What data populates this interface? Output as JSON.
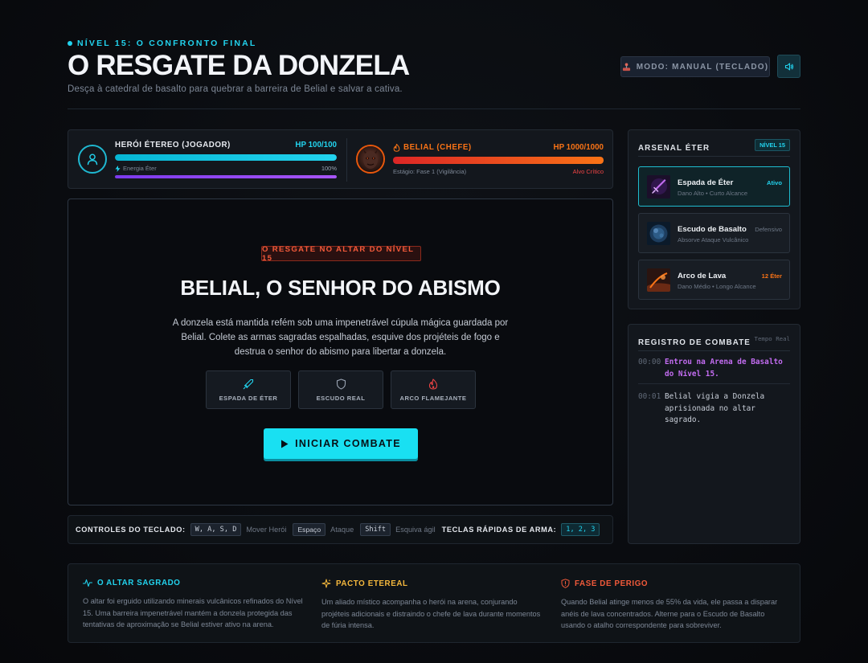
{
  "header": {
    "level_tag": "NÍVEL 15: O CONFRONTO FINAL",
    "title": "O RESGATE DA DONZELA",
    "subtitle": "Desça à catedral de basalto para quebrar a barreira de Belial e salvar a cativa.",
    "mode_label": "MODO: MANUAL (TECLADO)"
  },
  "hero": {
    "name": "HERÓI ÉTEREO (JOGADOR)",
    "hp": "HP 100/100",
    "hp_fraction": 1.0,
    "energy_label": "Energia Éter",
    "energy_pct": "100%",
    "energy_fraction": 1.0
  },
  "boss": {
    "name": "BELIAL (CHEFE)",
    "hp": "HP 1000/1000",
    "hp_fraction": 1.0,
    "stage": "Estágio: Fase 1 (Vigilância)",
    "critical": "Alvo Crítico"
  },
  "arena": {
    "badge": "O RESGATE NO ALTAR DO NÍVEL 15",
    "title": "BELIAL, O SENHOR DO ABISMO",
    "description": "A donzela está mantida refém sob uma impenetrável cúpula mágica guardada por Belial. Colete as armas sagradas espalhadas, esquive dos projéteis de fogo e destrua o senhor do abismo para libertar a donzela.",
    "weapons": [
      {
        "label": "ESPADA DE ÉTER",
        "icon": "sword-icon"
      },
      {
        "label": "ESCUDO REAL",
        "icon": "shield-icon"
      },
      {
        "label": "ARCO FLAMEJANTE",
        "icon": "flame-icon"
      }
    ],
    "start_label": "INICIAR COMBATE"
  },
  "controls": {
    "heading": "CONTROLES DO TECLADO:",
    "keys": [
      {
        "key": "W, A, S, D",
        "action": "Mover Herói"
      },
      {
        "key": "Espaço",
        "action": "Ataque"
      },
      {
        "key": "Shift",
        "action": "Esquiva ágil"
      }
    ],
    "hotkeys_heading": "TECLAS RÁPIDAS DE ARMA:",
    "hotkeys": "1, 2, 3"
  },
  "arsenal": {
    "title": "ARSENAL ÉTER",
    "level": "NÍVEL 15",
    "items": [
      {
        "name": "Espada de Éter",
        "sub": "Dano Alto • Curto Alcance",
        "tag": "Ativo",
        "tag_color": "#22d3ee"
      },
      {
        "name": "Escudo de Basalto",
        "sub": "Absorve Ataque Vulcânico",
        "tag": "Defensivo",
        "tag_color": "#6d7786"
      },
      {
        "name": "Arco de Lava",
        "sub": "Dano Médio • Longo Alcance",
        "tag": "12 Éter",
        "tag_color": "#f97316"
      }
    ]
  },
  "log": {
    "title": "REGISTRO DE COMBATE",
    "realtime": "Tempo Real",
    "entries": [
      {
        "time": "00:00",
        "text": "Entrou na Arena de Basalto do Nível 15.",
        "color": "#c26cf0"
      },
      {
        "time": "00:01",
        "text": "Belial vigia a Donzela aprisionada no altar sagrado.",
        "color": "#c8ced8"
      }
    ]
  },
  "footer": {
    "cols": [
      {
        "title": "O ALTAR SAGRADO",
        "color": "#22d3ee",
        "body": "O altar foi erguido utilizando minerais vulcânicos refinados do Nível 15. Uma barreira impenetrável mantém a donzela protegida das tentativas de aproximação se Belial estiver ativo na arena."
      },
      {
        "title": "PACTO ETEREAL",
        "color": "#f5b83d",
        "body": "Um aliado místico acompanha o herói na arena, conjurando projéteis adicionais e distraindo o chefe de lava durante momentos de fúria intensa."
      },
      {
        "title": "FASE DE PERIGO",
        "color": "#f25a3a",
        "body": "Quando Belial atinge menos de 55% da vida, ele passa a disparar anéis de lava concentrados. Alterne para o Escudo de Basalto usando o atalho correspondente para sobreviver."
      }
    ]
  }
}
